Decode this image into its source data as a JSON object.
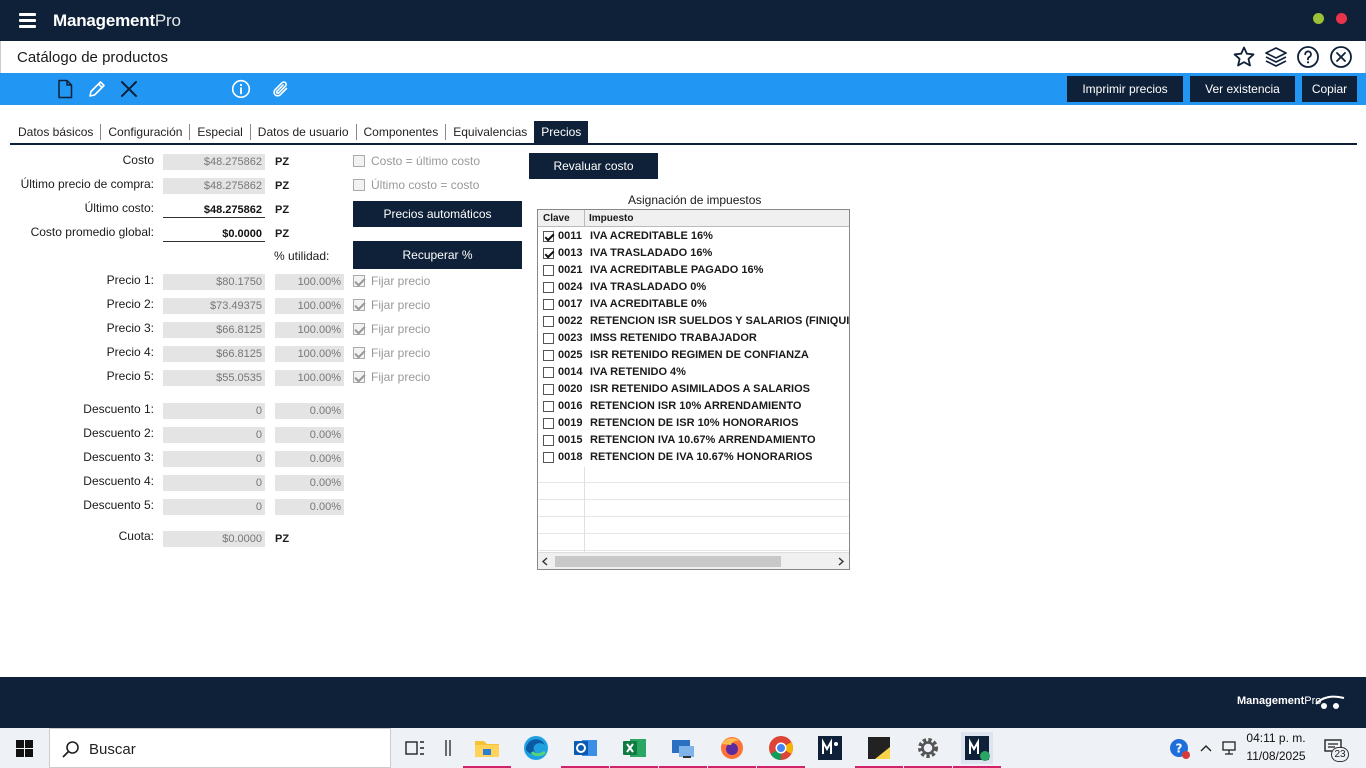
{
  "app": {
    "brand_bold": "Management",
    "brand_light": "Pro",
    "title": "Catálogo de productos"
  },
  "toolbar": {
    "print_prices": "Imprimir precios",
    "view_stock": "Ver existencia",
    "copy": "Copiar"
  },
  "tabs": [
    "Datos básicos",
    "Configuración",
    "Especial",
    "Datos de usuario",
    "Componentes",
    "Equivalencias",
    "Precios"
  ],
  "active_tab": "Precios",
  "costs": {
    "cost_label": "Costo",
    "cost_value": "$48.275862",
    "last_purchase_label": "Último precio de compra:",
    "last_purchase_value": "$48.275862",
    "last_cost_label": "Último costo:",
    "last_cost_value": "$48.275862",
    "avg_cost_label": "Costo promedio global:",
    "avg_cost_value": "$0.0000",
    "unit": "PZ"
  },
  "options": {
    "cost_eq_last": "Costo = último costo",
    "last_eq_cost": "Último costo = costo",
    "auto_prices": "Precios automáticos",
    "recover_pct": "Recuperar %",
    "revalue_cost": "Revaluar costo",
    "utility_label": "% utilidad:",
    "fix_price": "Fijar precio"
  },
  "prices": [
    {
      "label": "Precio 1:",
      "value": "$80.1750",
      "pct": "100.00%",
      "fixed": true
    },
    {
      "label": "Precio 2:",
      "value": "$73.49375",
      "pct": "100.00%",
      "fixed": true
    },
    {
      "label": "Precio 3:",
      "value": "$66.8125",
      "pct": "100.00%",
      "fixed": true
    },
    {
      "label": "Precio 4:",
      "value": "$66.8125",
      "pct": "100.00%",
      "fixed": true
    },
    {
      "label": "Precio 5:",
      "value": "$55.0535",
      "pct": "100.00%",
      "fixed": true
    }
  ],
  "discounts": [
    {
      "label": "Descuento 1:",
      "value": "0",
      "pct": "0.00%"
    },
    {
      "label": "Descuento 2:",
      "value": "0",
      "pct": "0.00%"
    },
    {
      "label": "Descuento 3:",
      "value": "0",
      "pct": "0.00%"
    },
    {
      "label": "Descuento 4:",
      "value": "0",
      "pct": "0.00%"
    },
    {
      "label": "Descuento 5:",
      "value": "0",
      "pct": "0.00%"
    }
  ],
  "quota": {
    "label": "Cuota:",
    "value": "$0.0000",
    "unit": "PZ"
  },
  "taxes": {
    "title": "Asignación de impuestos",
    "col_code": "Clave",
    "col_tax": "Impuesto",
    "rows": [
      {
        "code": "0011",
        "name": "IVA ACREDITABLE 16%",
        "checked": true
      },
      {
        "code": "0013",
        "name": "IVA TRASLADADO 16%",
        "checked": true
      },
      {
        "code": "0021",
        "name": "IVA ACREDITABLE PAGADO 16%",
        "checked": false
      },
      {
        "code": "0024",
        "name": "IVA TRASLADADO 0%",
        "checked": false
      },
      {
        "code": "0017",
        "name": "IVA ACREDITABLE 0%",
        "checked": false
      },
      {
        "code": "0022",
        "name": "RETENCION ISR SUELDOS Y SALARIOS (FINIQUITOS)",
        "checked": false
      },
      {
        "code": "0023",
        "name": "IMSS RETENIDO TRABAJADOR",
        "checked": false
      },
      {
        "code": "0025",
        "name": "ISR RETENIDO REGIMEN DE CONFIANZA",
        "checked": false
      },
      {
        "code": "0014",
        "name": "IVA RETENIDO 4%",
        "checked": false
      },
      {
        "code": "0020",
        "name": "ISR RETENIDO ASIMILADOS A SALARIOS",
        "checked": false
      },
      {
        "code": "0016",
        "name": "RETENCION ISR 10% ARRENDAMIENTO",
        "checked": false
      },
      {
        "code": "0019",
        "name": "RETENCION DE ISR 10% HONORARIOS",
        "checked": false
      },
      {
        "code": "0015",
        "name": "RETENCION IVA 10.67% ARRENDAMIENTO",
        "checked": false
      },
      {
        "code": "0018",
        "name": "RETENCION DE IVA 10.67% HONORARIOS",
        "checked": false
      }
    ]
  },
  "footer": {
    "brand_bold": "Management",
    "brand_light": "Pro"
  },
  "taskbar": {
    "search": "Buscar",
    "time": "04:11 p. m.",
    "date": "11/08/2025",
    "notifications": "23"
  },
  "colors": {
    "navy": "#0f2138",
    "blue": "#2196f3",
    "accent": "#d2236a"
  }
}
